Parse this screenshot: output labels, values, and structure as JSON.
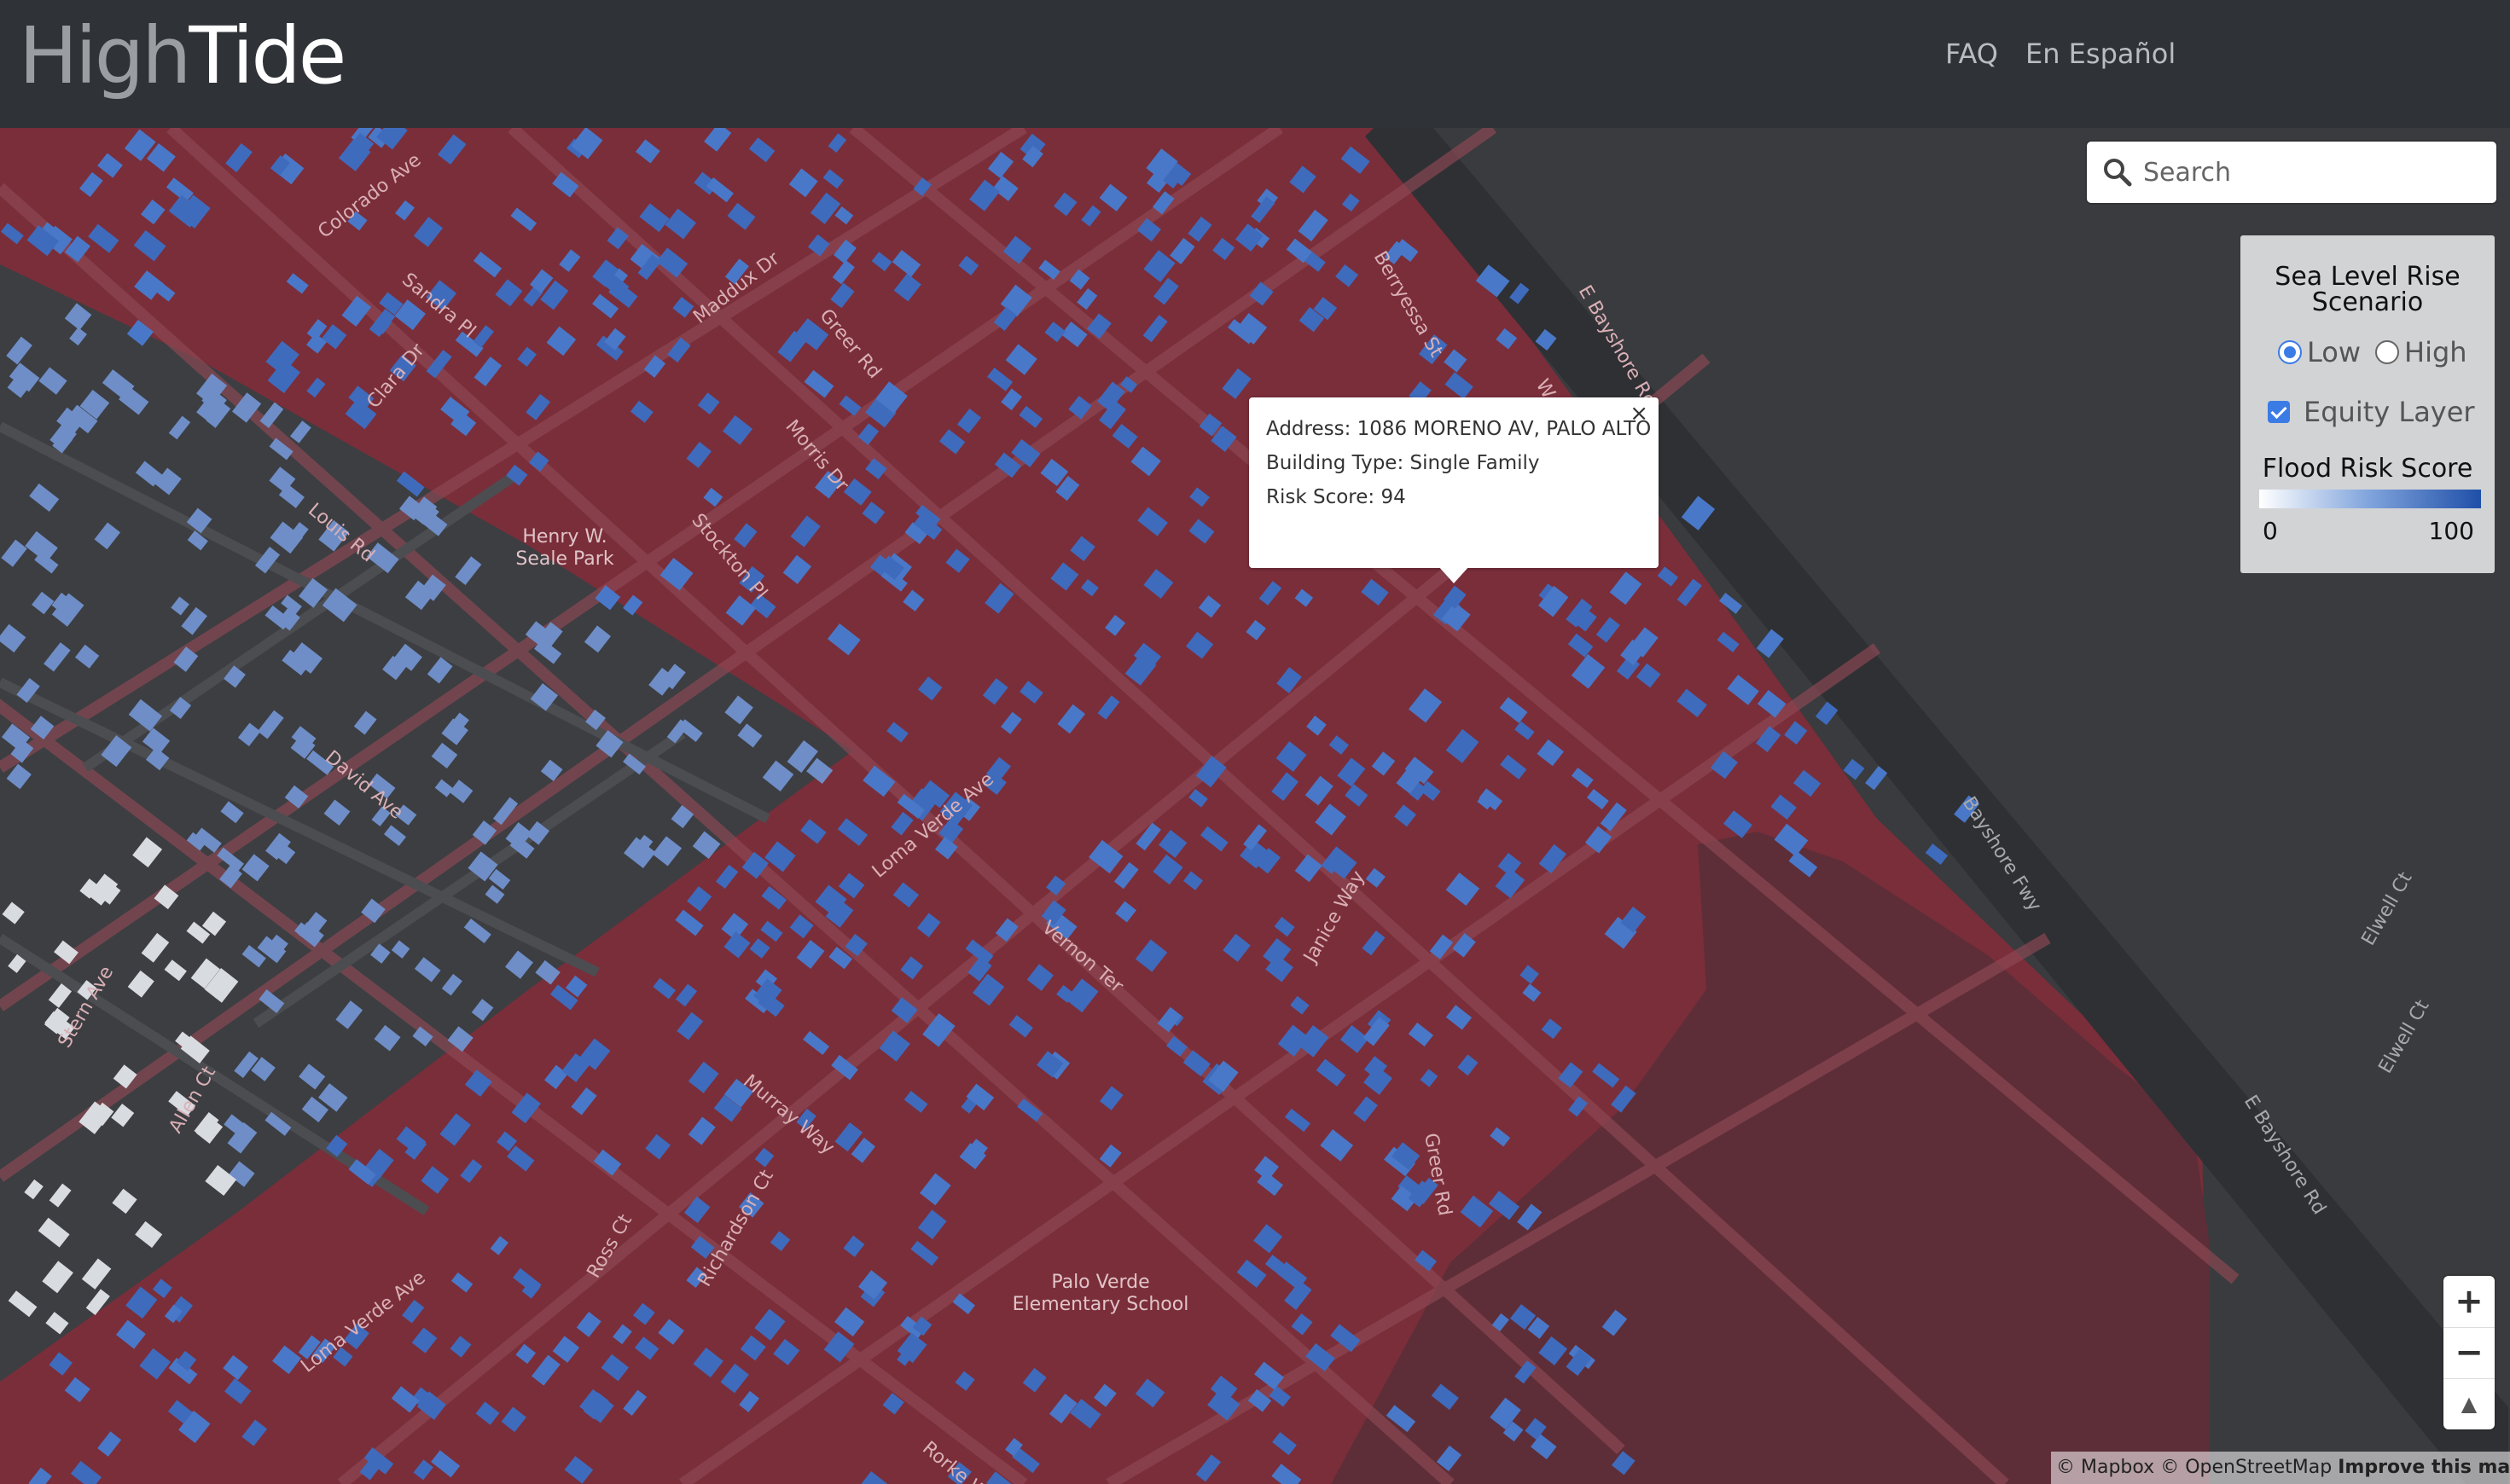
{
  "app": {
    "logo_part1": "High",
    "logo_part2": "Tide"
  },
  "nav": {
    "faq": "FAQ",
    "spanish": "En Español"
  },
  "search": {
    "placeholder": "Search"
  },
  "legend": {
    "title_line1": "Sea Level Rise",
    "title_line2": "Scenario",
    "options": [
      {
        "label": "Low",
        "selected": true
      },
      {
        "label": "High",
        "selected": false
      }
    ],
    "equity_layer_label": "Equity Layer",
    "equity_layer_checked": true,
    "score_title": "Flood Risk Score",
    "score_min": "0",
    "score_max": "100",
    "gradient_colors": [
      "#ffffff",
      "#1f4fa8"
    ]
  },
  "popup": {
    "address": "Address: 1086 MORENO AV, PALO ALTO",
    "building_type": "Building Type: Single Family",
    "risk_score": "Risk Score: 94",
    "close": "×"
  },
  "map": {
    "flood_zone_color": "#7a2e3a",
    "base_color": "#3a3b3e",
    "street_labels": [
      "Colorado Ave",
      "Sandra Pl",
      "Clara Dr",
      "Louis Rd",
      "Maddux Dr",
      "Greer Rd",
      "Morris Dr",
      "Stockton Pl",
      "Berryessa St",
      "E Bayshore Rd",
      "W Ba",
      "David Ave",
      "Loma Verde Ave",
      "Vernon Ter",
      "Janice Way",
      "Murray Way",
      "Greer Rd",
      "Bayshore Fwy",
      "E Bayshore Rd",
      "Elwell Ct",
      "Elwell Ct",
      "Stern Ave",
      "Allen Ct",
      "Ross Ct",
      "Richardson Ct",
      "Loma Verde Ave",
      "Rorke Way"
    ],
    "place_labels": [
      {
        "line1": "Henry W.",
        "line2": "Seale Park"
      },
      {
        "line1": "Palo Verde",
        "line2": "Elementary School"
      }
    ]
  },
  "zoom": {
    "in": "+",
    "out": "−",
    "north": "▲"
  },
  "attribution": {
    "mapbox": "© Mapbox",
    "osm": "© OpenStreetMap",
    "improve": "Improve this map"
  }
}
